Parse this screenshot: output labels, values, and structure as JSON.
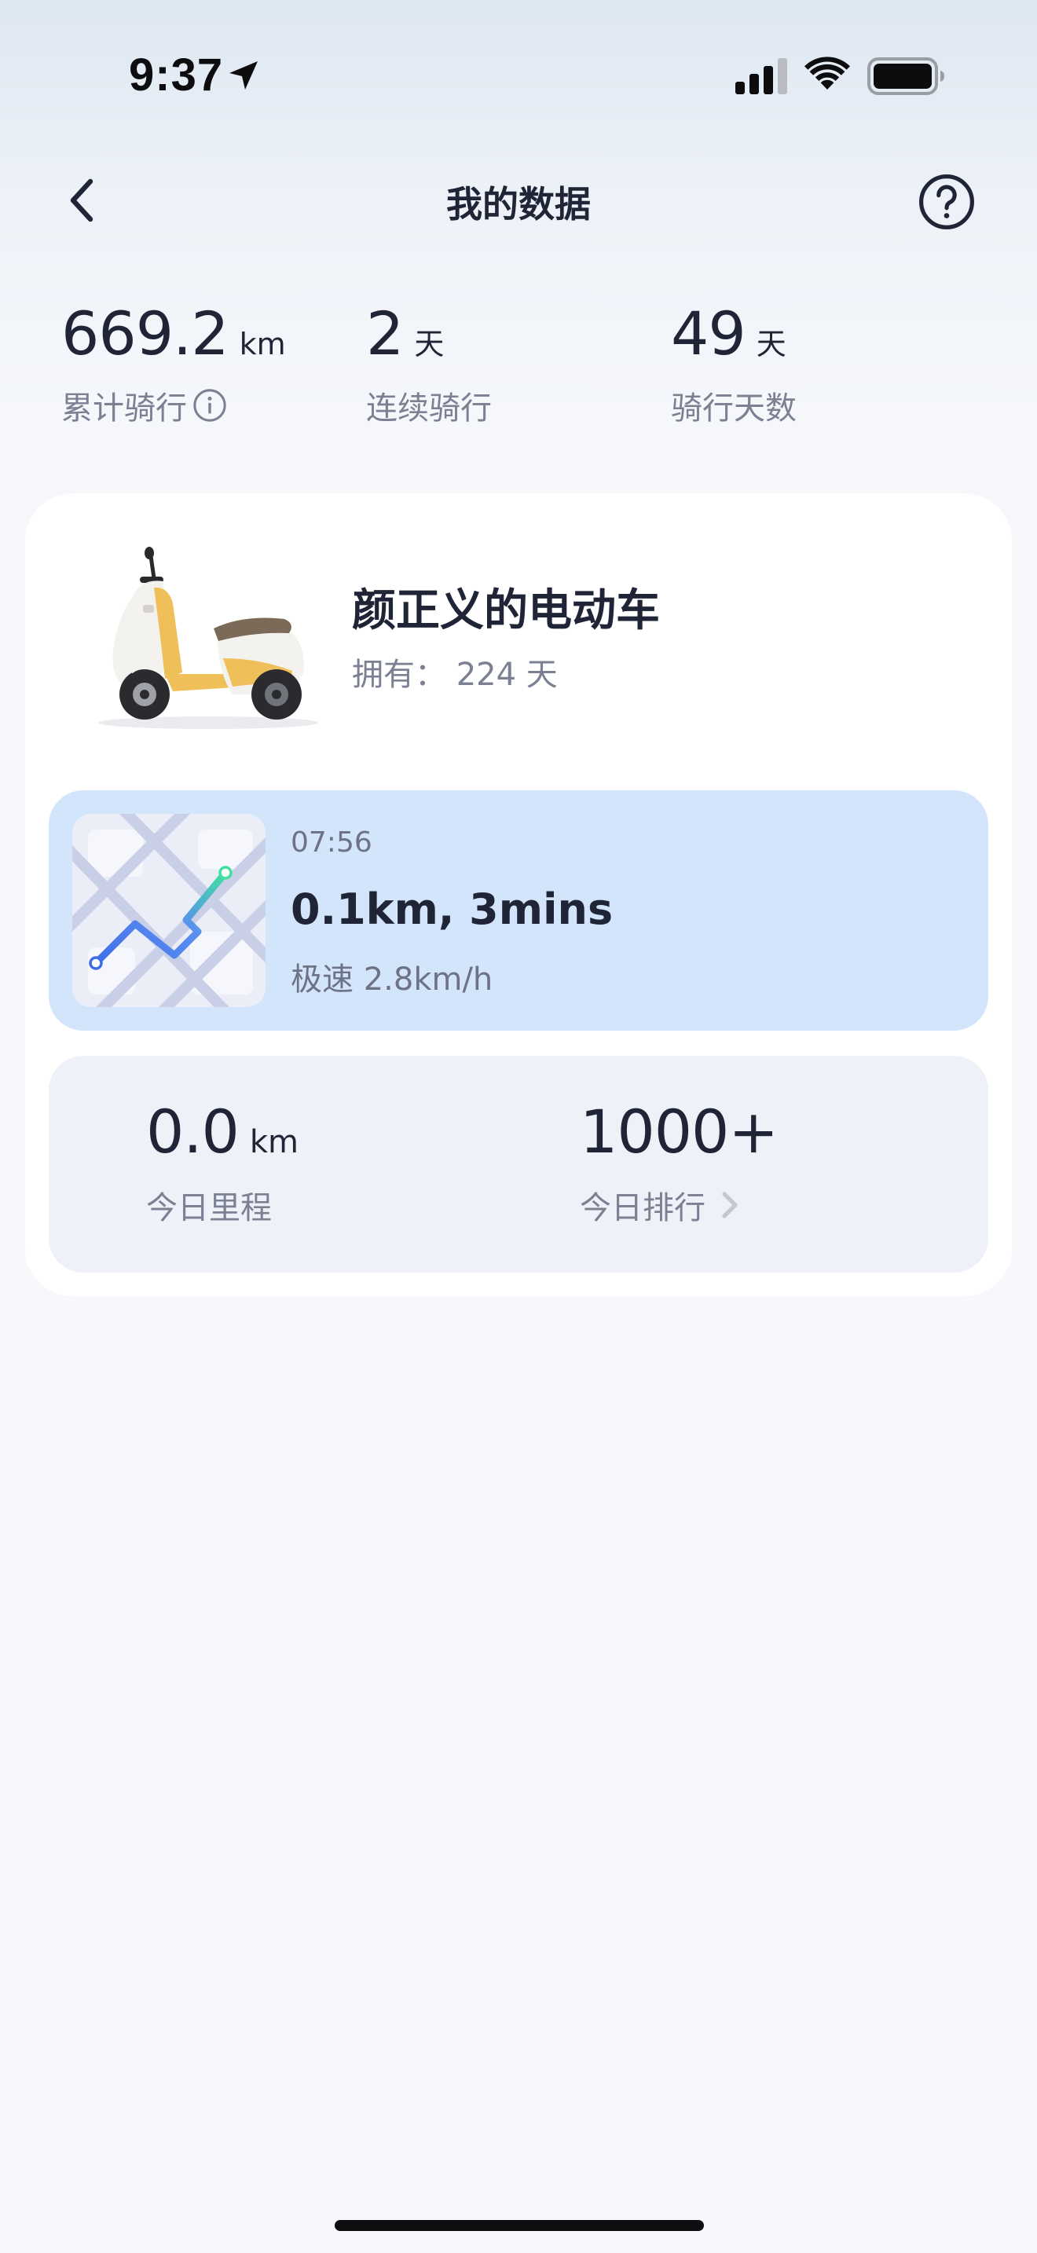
{
  "status_bar": {
    "time": "9:37",
    "icons": [
      "location-arrow-icon",
      "cellular-signal-icon",
      "wifi-icon",
      "battery-icon"
    ]
  },
  "header": {
    "title": "我的数据",
    "back_icon": "chevron-left-icon",
    "help_icon": "question-circle-icon"
  },
  "summary": {
    "total_distance": {
      "value": "669.2",
      "unit": "km",
      "label": "累计骑行",
      "icon": "info-icon"
    },
    "streak": {
      "value": "2",
      "unit": "天",
      "label": "连续骑行"
    },
    "ride_days": {
      "value": "49",
      "unit": "天",
      "label": "骑行天数"
    }
  },
  "vehicle": {
    "name": "颜正义的电动车",
    "owned_label": "拥有：",
    "owned_value": "224",
    "owned_unit": "天",
    "image": "scooter-image"
  },
  "latest_ride": {
    "time": "07:56",
    "summary": "0.1km, 3mins",
    "speed": "极速 2.8km/h",
    "thumbnail": "route-map-thumbnail"
  },
  "today": {
    "mileage": {
      "value": "0.0",
      "unit": "km",
      "label": "今日里程"
    },
    "ranking": {
      "value": "1000+",
      "label": "今日排行",
      "icon": "chevron-right-icon"
    }
  },
  "colors": {
    "accent_ride_card": "#d3e5fa",
    "today_card": "#eef1f8",
    "primary_text": "#1f2536",
    "secondary_text": "#7b8193"
  }
}
